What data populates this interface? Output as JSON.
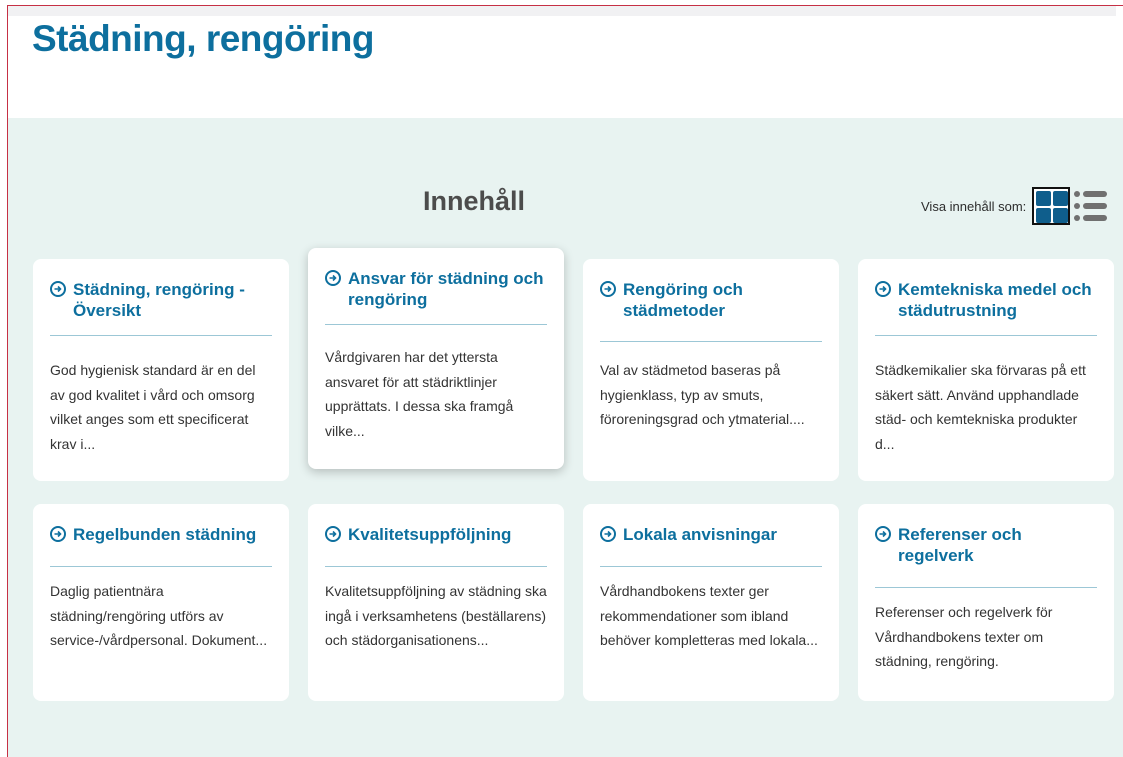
{
  "page": {
    "title": "Städning, rengöring"
  },
  "content": {
    "heading": "Innehåll",
    "view_toggle": {
      "label": "Visa innehåll som:",
      "grid_icon": "grid-view-icon",
      "list_icon": "list-view-icon",
      "selected": "grid"
    }
  },
  "cards": [
    {
      "title": "Städning, rengöring - Översikt",
      "text": "God hygienisk standard är en del av god kvalitet i vård och omsorg vilket anges som ett specificerat krav i..."
    },
    {
      "title": "Ansvar för städning och rengöring",
      "text": "Vårdgivaren har det yttersta ansvaret för att städriktlinjer upprättats. I dessa ska framgå vilke..."
    },
    {
      "title": "Rengöring och städmetoder",
      "text": "Val av städmetod baseras på hygienklass, typ av smuts, föroreningsgrad och ytmaterial...."
    },
    {
      "title": "Kemtekniska medel och städutrustning",
      "text": "Städkemikalier ska förvaras på ett säkert sätt. Använd upphandlade städ- och kemtekniska produkter d..."
    },
    {
      "title": "Regelbunden städning",
      "text": "Daglig patientnära städning/rengöring utförs av service-/vårdpersonal. Dokument..."
    },
    {
      "title": "Kvalitetsuppföljning",
      "text": "Kvalitetsuppföljning av städning ska ingå i verksamhetens (beställarens) och städorganisationens..."
    },
    {
      "title": "Lokala anvisningar",
      "text": "Vårdhandbokens texter ger rekommendationer som ibland behöver kompletteras med lokala..."
    },
    {
      "title": "Referenser och regelverk",
      "text": "Referenser och regelverk för Vårdhandbokens texter om städning, rengöring."
    }
  ],
  "colors": {
    "accent": "#0d6f9e",
    "content_background": "#e8f3f1",
    "frame": "#c63045"
  }
}
